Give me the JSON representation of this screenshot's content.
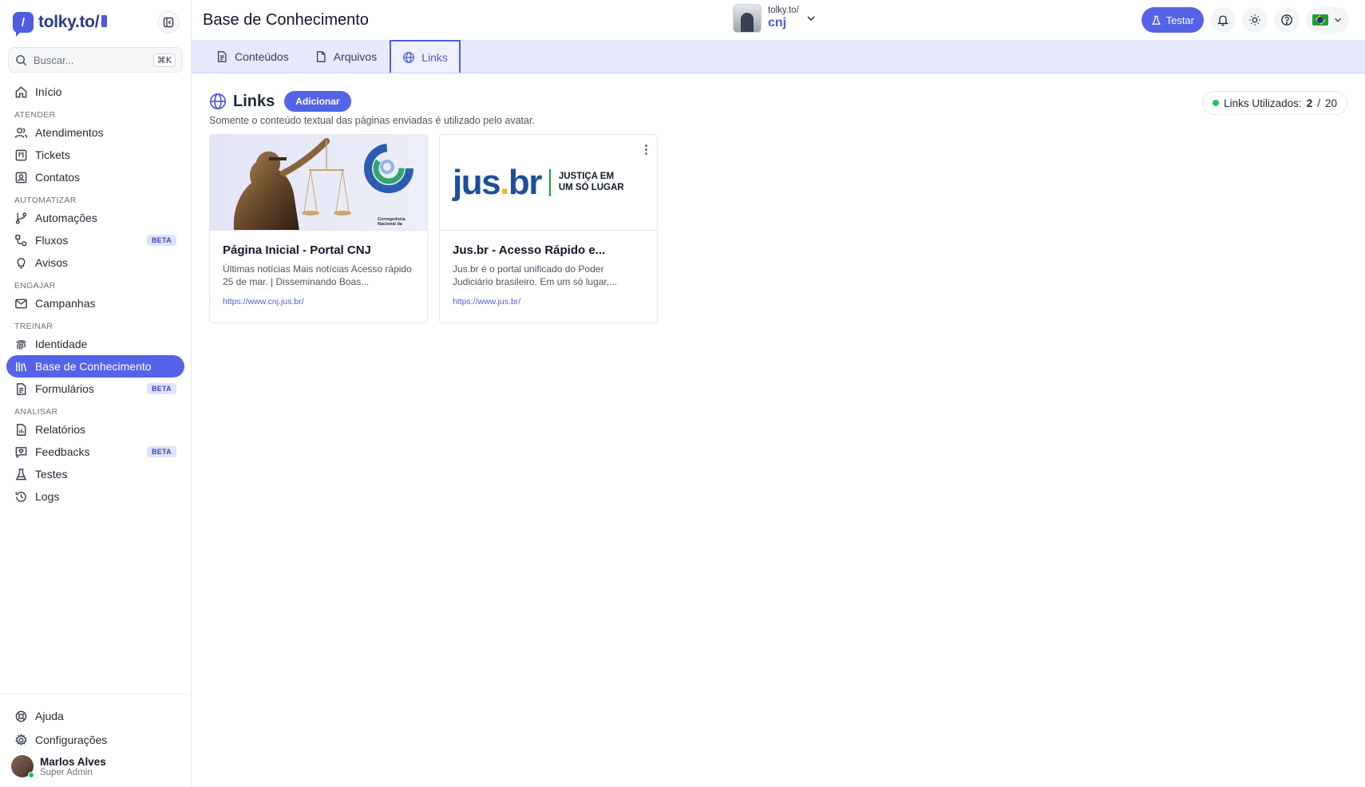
{
  "brand": {
    "name": "tolky.to/"
  },
  "search": {
    "placeholder": "Buscar...",
    "shortcut": "⌘K"
  },
  "nav": {
    "home": "Início",
    "sections": {
      "atender": "ATENDER",
      "automatizar": "AUTOMATIZAR",
      "engajar": "ENGAJAR",
      "treinar": "TREINAR",
      "analisar": "ANALISAR"
    },
    "items": {
      "atendimentos": "Atendimentos",
      "tickets": "Tickets",
      "contatos": "Contatos",
      "automacoes": "Automações",
      "fluxos": "Fluxos",
      "avisos": "Avisos",
      "campanhas": "Campanhas",
      "identidade": "Identidade",
      "base": "Base de Conhecimento",
      "formularios": "Formulários",
      "relatorios": "Relatórios",
      "feedbacks": "Feedbacks",
      "testes": "Testes",
      "logs": "Logs"
    },
    "beta": "BETA",
    "help": "Ajuda",
    "settings": "Configurações"
  },
  "user": {
    "name": "Marlos Alves",
    "role": "Super Admin"
  },
  "header": {
    "title": "Base de Conhecimento",
    "workspace_domain": "tolky.to/",
    "workspace_name": "cnj",
    "test_label": "Testar"
  },
  "tabs": {
    "conteudos": "Conteúdos",
    "arquivos": "Arquivos",
    "links": "Links"
  },
  "links": {
    "title": "Links",
    "add_label": "Adicionar",
    "subtitle": "Somente o conteúdo textual das páginas enviadas é utilizado pelo avatar.",
    "usage_label": "Links Utilizados:",
    "usage_used": "2",
    "usage_sep": "/",
    "usage_total": "20"
  },
  "cards": [
    {
      "title": "Página Inicial - Portal CNJ",
      "desc": "Últimas notícias Mais notícias Acesso rápido 25 de mar. | Disseminando Boas...",
      "url": "https://www.cnj.jus.br/",
      "image_caption": "Corregedoria Nacional da"
    },
    {
      "title": "Jus.br - Acesso Rápido e...",
      "desc": "Jus.br é o portal unificado do Poder Judiciário brasileiro. Em um só lugar,...",
      "url": "https://www.jus.br/",
      "logo_word": "jus",
      "logo_dot": ".",
      "logo_tld": "br",
      "logo_tag_1": "JUSTIÇA EM",
      "logo_tag_2": "UM SÓ LUGAR"
    }
  ],
  "colors": {
    "accent": "#5563e8",
    "tab_bar": "#e7eafd",
    "online": "#22c55e"
  }
}
